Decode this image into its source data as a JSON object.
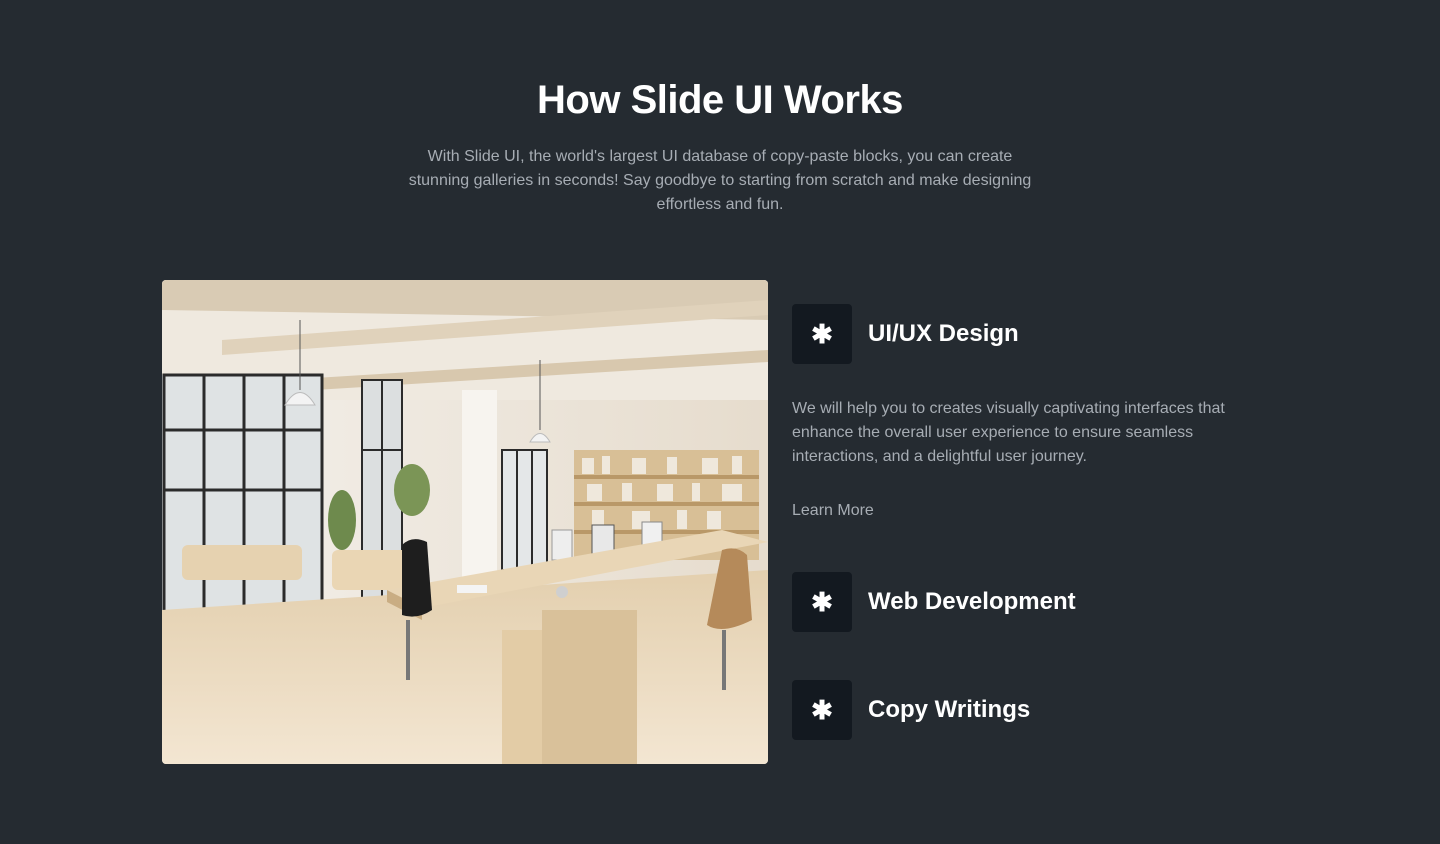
{
  "header": {
    "title": "How Slide UI Works",
    "subtitle": "With Slide UI, the world's largest UI database of copy-paste blocks, you can create stunning galleries in seconds! Say goodbye to starting from scratch and make designing effortless and fun."
  },
  "features": [
    {
      "icon": "asterisk-icon",
      "icon_glyph": "✱",
      "title": "UI/UX Design",
      "description": "We will help you to creates visually captivating interfaces that enhance the overall user experience to ensure seamless interactions, and a delightful user journey.",
      "link_label": "Learn More"
    },
    {
      "icon": "asterisk-icon",
      "icon_glyph": "✱",
      "title": "Web Development"
    },
    {
      "icon": "asterisk-icon",
      "icon_glyph": "✱",
      "title": "Copy Writings"
    }
  ],
  "colors": {
    "background": "#252b31",
    "icon_box": "#131920",
    "text_primary": "#ffffff",
    "text_secondary": "#a7adb4"
  }
}
